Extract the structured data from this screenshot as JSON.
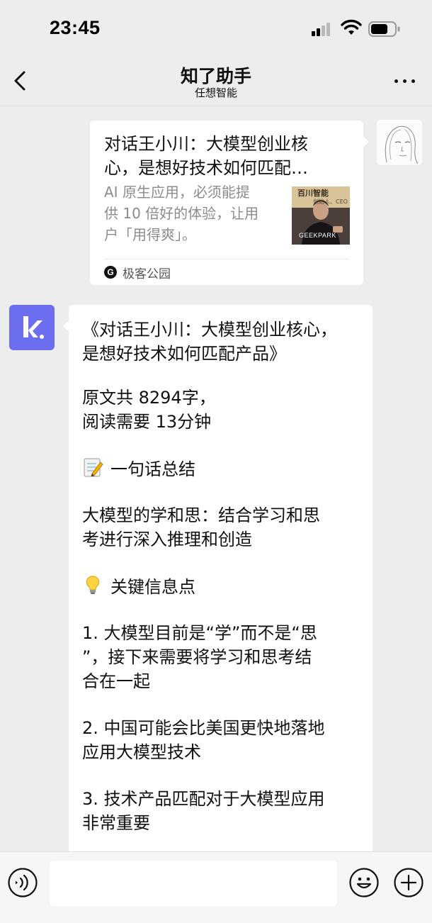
{
  "status_bar": {
    "time": "23:45"
  },
  "nav": {
    "title": "知了助手",
    "subtitle": "任想智能"
  },
  "user_card": {
    "title_line1": "对话王小川：大模型创业核",
    "title_line2": "心，是想好技术如何匹配…",
    "desc_line1": "AI 原生应用，必须能提",
    "desc_line2": "供 10 倍好的体验，让用",
    "desc_line3": "户「用得爽」。",
    "thumbnail": {
      "top_text": "百川智能",
      "sub_text": "创始人、CEO",
      "bottom_text": "GEEKPARK"
    },
    "source_icon_letter": "G",
    "source_name": "极客公园"
  },
  "bot_message": {
    "lines": [
      "《对话王小川：大模型创业核心，",
      "是想好技术如何匹配产品》",
      "原文共 8294字，",
      "阅读需要 13分钟",
      "一句话总结",
      "大模型的学和思：结合学习和思",
      "考进行深入推理和创造",
      "关键信息点",
      "1. 大模型目前是“学”而不是“思",
      "”，接下来需要将学习和思考结",
      "合在一起",
      "2. 中国可能会比美国更快地落地",
      "应用大模型技术",
      "3. 技术产品匹配对于大模型应用",
      "非常重要"
    ],
    "summary_icon": "memo-emoji",
    "keypoints_icon": "lightbulb-emoji"
  },
  "input_bar": {
    "value": "",
    "placeholder": ""
  },
  "colors": {
    "background": "#ededed",
    "bot_avatar": "#6d6df0",
    "bubble": "#ffffff"
  }
}
